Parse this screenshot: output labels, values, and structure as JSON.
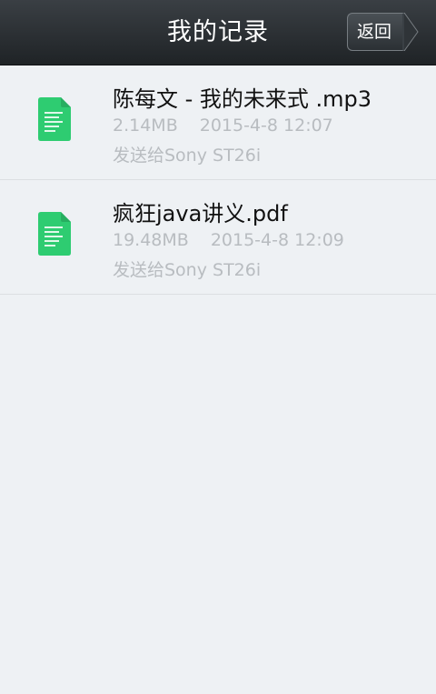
{
  "header": {
    "title": "我的记录",
    "back_label": "返回"
  },
  "colors": {
    "accent_green": "#2ecc71",
    "meta_gray": "#b8bcc0",
    "header_dark": "#2b3034"
  },
  "records": [
    {
      "icon": "document-icon",
      "name": "陈每文 - 我的未来式 .mp3",
      "size": "2.14MB",
      "date": "2015-4-8 12:07",
      "target": "发送给Sony ST26i"
    },
    {
      "icon": "document-icon",
      "name": "疯狂java讲义.pdf",
      "size": "19.48MB",
      "date": "2015-4-8 12:09",
      "target": "发送给Sony ST26i"
    }
  ]
}
